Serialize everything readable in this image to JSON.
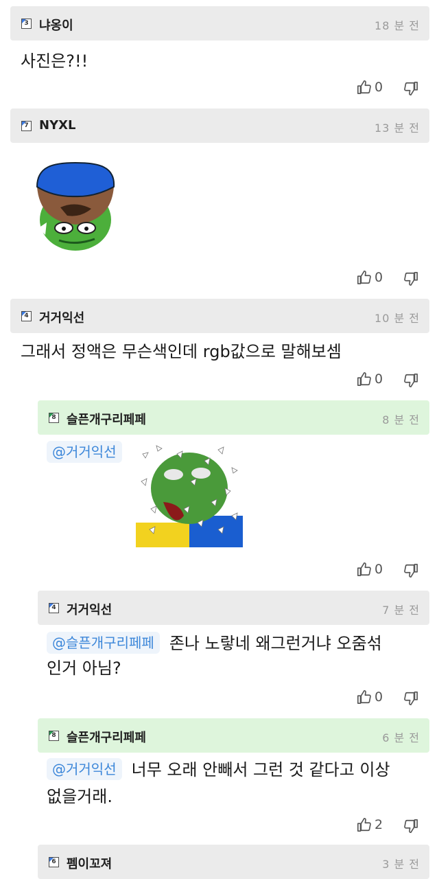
{
  "comments": [
    {
      "level": "3",
      "nick": "냐옹이",
      "time": "18 분 전",
      "text": "사진은?!!",
      "up": "0"
    },
    {
      "level": "7",
      "nick": "NYXL",
      "time": "13 분 전",
      "up": "0"
    },
    {
      "level": "4",
      "nick": "거거익선",
      "time": "10 분 전",
      "text": "그래서 정액은 무슨색인데 rgb값으로 말해보셈",
      "up": "0"
    },
    {
      "level": "8",
      "nick": "슬픈개구리페페",
      "time": "8 분 전",
      "mention": "@거거익선",
      "up": "0"
    },
    {
      "level": "4",
      "nick": "거거익선",
      "time": "7 분 전",
      "mention": "@슬픈개구리페페",
      "text_line1": "존나 노랗네 왜그런거냐 오줌섞",
      "text_line2": "인거 아님?",
      "up": "0"
    },
    {
      "level": "8",
      "nick": "슬픈개구리페페",
      "time": "6 분 전",
      "mention": "@거거익선",
      "text_line1": "너무 오래 안빼서 그런 것 같다고 이상",
      "text_line2": "없을거래.",
      "up": "2"
    },
    {
      "level": "6",
      "nick": "펨이꼬져",
      "time": "3 분 전"
    }
  ],
  "icons": {
    "upvote": "thumbs-up-icon",
    "downvote": "thumbs-down-icon"
  },
  "colors": {
    "header": "#ebebeb",
    "reply_header": "#def5dc",
    "mention": "#3b86d9",
    "time": "#9a9a9a"
  }
}
